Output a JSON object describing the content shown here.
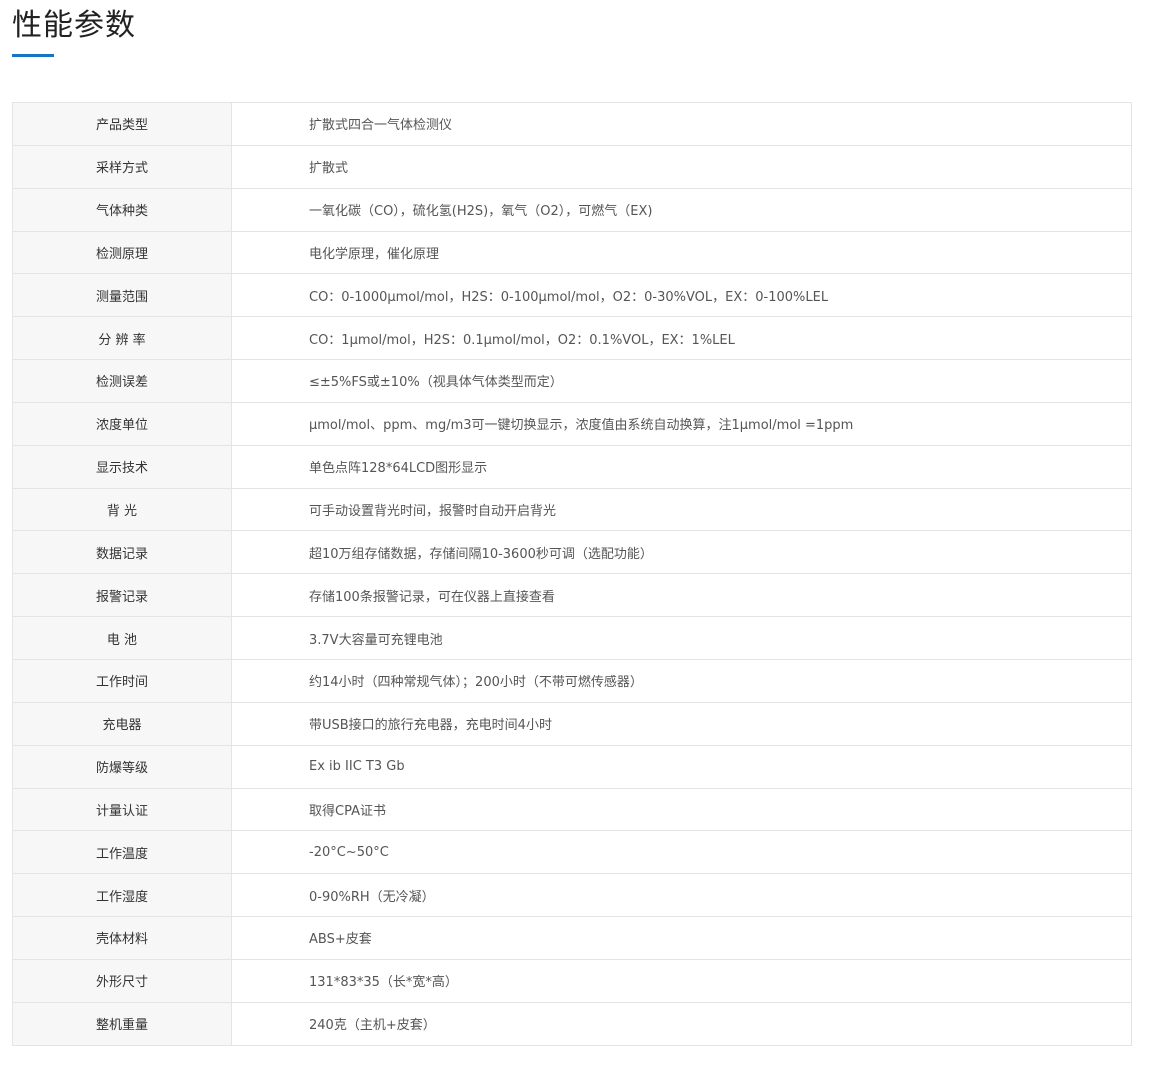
{
  "section": {
    "title": "性能参数",
    "accent_color": "#1a73c2"
  },
  "specs": [
    {
      "label": "产品类型",
      "value": "扩散式四合一气体检测仪"
    },
    {
      "label": "采样方式",
      "value": "扩散式"
    },
    {
      "label": "气体种类",
      "value": "一氧化碳（CO），硫化氢(H2S)，氧气（O2），可燃气（EX)"
    },
    {
      "label": "检测原理",
      "value": "电化学原理，催化原理"
    },
    {
      "label": "测量范围",
      "value": "CO：0-1000μmol/mol，H2S：0-100μmol/mol，O2：0-30%VOL，EX：0-100%LEL"
    },
    {
      "label": "分 辨 率",
      "value": "CO：1μmol/mol，H2S：0.1μmol/mol，O2：0.1%VOL，EX：1%LEL"
    },
    {
      "label": "检测误差",
      "value": "≤±5%FS或±10%（视具体气体类型而定）"
    },
    {
      "label": "浓度单位",
      "value": "μmol/mol、ppm、mg/m3可一键切换显示，浓度值由系统自动换算，注1μmol/mol =1ppm"
    },
    {
      "label": "显示技术",
      "value": "单色点阵128*64LCD图形显示"
    },
    {
      "label": "背 光",
      "value": "可手动设置背光时间，报警时自动开启背光"
    },
    {
      "label": "数据记录",
      "value": "超10万组存储数据，存储间隔10-3600秒可调（选配功能）"
    },
    {
      "label": "报警记录",
      "value": "存储100条报警记录，可在仪器上直接查看"
    },
    {
      "label": "电 池",
      "value": "3.7V大容量可充锂电池"
    },
    {
      "label": "工作时间",
      "value": "约14小时（四种常规气体）；200小时（不带可燃传感器）"
    },
    {
      "label": "充电器",
      "value": "带USB接口的旅行充电器，充电时间4小时"
    },
    {
      "label": "防爆等级",
      "value": "Ex ib IIC T3 Gb"
    },
    {
      "label": "计量认证",
      "value": "取得CPA证书"
    },
    {
      "label": "工作温度",
      "value": "-20°C~50°C"
    },
    {
      "label": "工作湿度",
      "value": "0-90%RH（无冷凝）"
    },
    {
      "label": "壳体材料",
      "value": "ABS+皮套"
    },
    {
      "label": "外形尺寸",
      "value": "131*83*35（长*宽*高）"
    },
    {
      "label": "整机重量",
      "value": "240克（主机+皮套）"
    }
  ]
}
